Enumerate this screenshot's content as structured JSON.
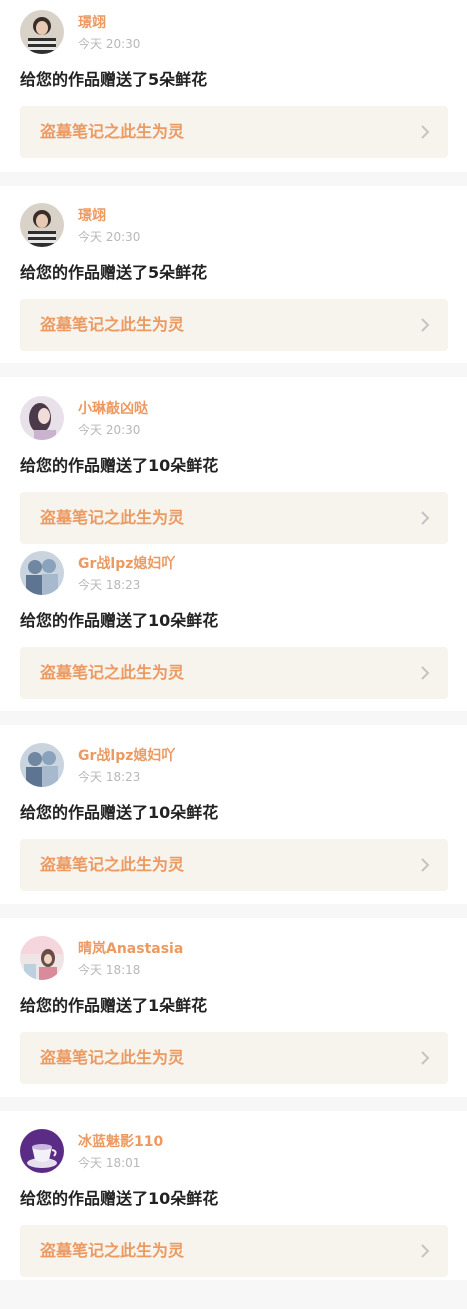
{
  "notifications": [
    {
      "user": "璟翊",
      "time": "今天 20:30",
      "message": "给您的作品赠送了5朵鲜花",
      "work_title": "盗墓笔记之此生为灵",
      "avatar": "avatar-striped-shirt"
    },
    {
      "user": "璟翊",
      "time": "今天 20:30",
      "message": "给您的作品赠送了5朵鲜花",
      "work_title": "盗墓笔记之此生为灵",
      "avatar": "avatar-striped-shirt"
    },
    {
      "user": "小琳敲凶哒",
      "time": "今天 20:30",
      "message": "给您的作品赠送了10朵鲜花",
      "work_title": "盗墓笔记之此生为灵",
      "avatar": "avatar-purple-girl"
    },
    {
      "user": "Gr战lpz媳妇吖",
      "time": "今天 18:23",
      "message": "给您的作品赠送了10朵鲜花",
      "work_title": "盗墓笔记之此生为灵",
      "avatar": "avatar-blue-figures"
    },
    {
      "user": "Gr战lpz媳妇吖",
      "time": "今天 18:23",
      "message": "给您的作品赠送了10朵鲜花",
      "work_title": "盗墓笔记之此生为灵",
      "avatar": "avatar-blue-figures"
    },
    {
      "user": "晴岚Anastasia",
      "time": "今天 18:18",
      "message": "给您的作品赠送了1朵鲜花",
      "work_title": "盗墓笔记之此生为灵",
      "avatar": "avatar-pink-scene"
    },
    {
      "user": "冰蓝魅影110",
      "time": "今天 18:01",
      "message": "给您的作品赠送了10朵鲜花",
      "work_title": "盗墓笔记之此生为灵",
      "avatar": "avatar-purple-cup"
    }
  ],
  "icons": {
    "chevron": "chevron-right-icon"
  },
  "colors": {
    "accent": "#ec9a62",
    "card_bg": "#f6f4ed",
    "divider": "#f7f7f7"
  }
}
